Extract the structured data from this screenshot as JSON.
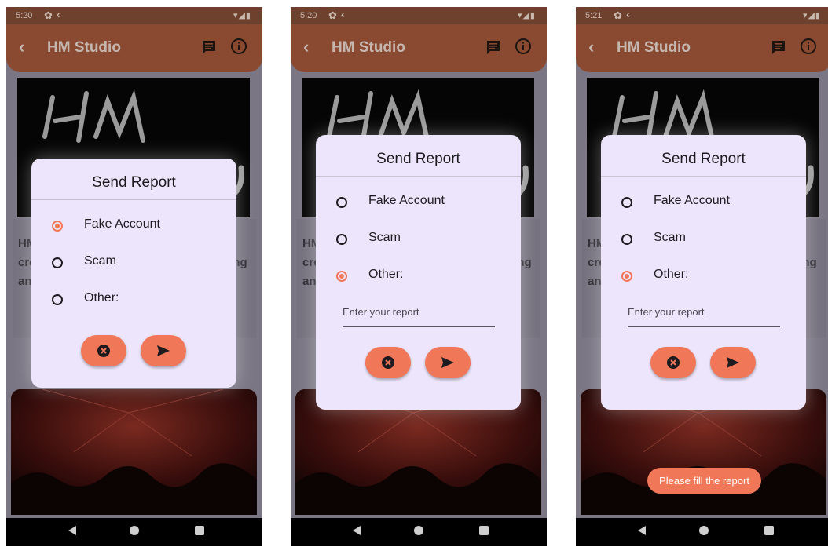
{
  "colors": {
    "accent": "#f07858",
    "dialog_bg": "#ede5fb",
    "appbar": "#8a4a31",
    "overlay": "#7a7684"
  },
  "screens": [
    {
      "status": {
        "time": "5:20"
      },
      "app": {
        "title": "HM Studio"
      },
      "content_text": "HM Studio is an innovative content creator dedicated to producing engaging and",
      "dialog": {
        "title": "Send Report",
        "options": [
          {
            "label": "Fake Account",
            "selected": true
          },
          {
            "label": "Scam",
            "selected": false
          },
          {
            "label": "Other:",
            "selected": false
          }
        ]
      }
    },
    {
      "status": {
        "time": "5:20"
      },
      "app": {
        "title": "HM Studio"
      },
      "content_text": "HM Studio is an innovative content creator dedicated to producing engaging and",
      "dialog": {
        "title": "Send Report",
        "options": [
          {
            "label": "Fake Account",
            "selected": false
          },
          {
            "label": "Scam",
            "selected": false
          },
          {
            "label": "Other:",
            "selected": true
          }
        ],
        "report_placeholder": "Enter your report"
      }
    },
    {
      "status": {
        "time": "5:21"
      },
      "app": {
        "title": "HM Studio"
      },
      "content_text": "HM Studio is an innovative content creator dedicated to producing engaging and",
      "dialog": {
        "title": "Send Report",
        "options": [
          {
            "label": "Fake Account",
            "selected": false
          },
          {
            "label": "Scam",
            "selected": false
          },
          {
            "label": "Other:",
            "selected": true
          }
        ],
        "report_placeholder": "Enter your report"
      },
      "toast": "Please fill the report"
    }
  ]
}
